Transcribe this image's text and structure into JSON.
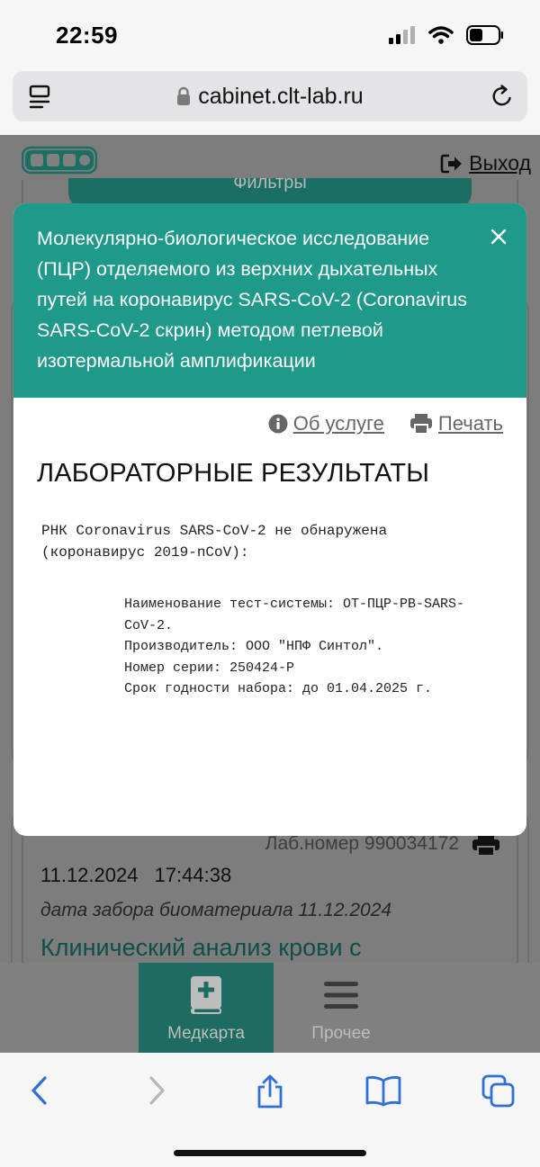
{
  "status_bar": {
    "time": "22:59"
  },
  "browser": {
    "url": "cabinet.clt-lab.ru"
  },
  "page": {
    "logout_label": "Выход",
    "filters_label": "Фильтры",
    "record": {
      "lab_number": "Лаб.номер 990034172",
      "datetime": "11.12.2024 17:44:38",
      "collection_date": "дата забора биоматериала 11.12.2024",
      "title": "Клинический анализ крови с"
    }
  },
  "modal": {
    "title": "Молекулярно-биологическое исследование (ПЦР) отделяемого из верхних дыхательных путей на коронавирус SARS-CoV-2 (Coronavirus SARS-CoV-2 скрин) методом петлевой изотермальной амплификации",
    "about_label": "Об услуге",
    "print_label": "Печать",
    "results_heading": "ЛАБОРАТОРНЫЕ РЕЗУЛЬТАТЫ",
    "result_line_1": "РНК Coronavirus SARS-CoV-2 не обнаружена",
    "result_line_2": "(коронавирус 2019-nCoV):",
    "details": [
      "Наименование тест-системы: ОТ-ПЦР-РВ-SARS-",
      "CoV-2.",
      "Производитель: ООО \"НПФ Синтол\".",
      "Номер серии: 250424-Р",
      "Срок годности набора: до 01.04.2025 г."
    ]
  },
  "app_nav": {
    "items": [
      {
        "label": "Медкарта",
        "icon": "medical-book-icon",
        "active": true
      },
      {
        "label": "Прочее",
        "icon": "hamburger-menu-icon",
        "active": false
      }
    ]
  },
  "colors": {
    "modal_header": "#1f9a8a",
    "nav_active": "#1d6b61",
    "ios_blue": "#2f6fd6"
  }
}
